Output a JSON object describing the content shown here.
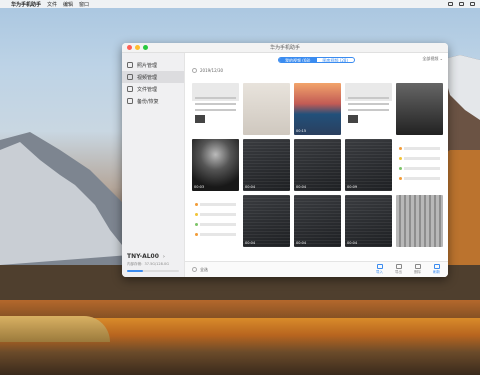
{
  "menubar": {
    "app_name": "华为手机助手",
    "items": [
      "文件",
      "编辑",
      "窗口"
    ],
    "battery": "",
    "icons": [
      "apple-icon",
      "wifi-icon",
      "search-icon",
      "menu-icon"
    ]
  },
  "window": {
    "title": "华为手机助手"
  },
  "sidebar": {
    "items": [
      {
        "label": "照片管理",
        "icon": "photo-icon"
      },
      {
        "label": "视频管理",
        "icon": "video-icon"
      },
      {
        "label": "文件管理",
        "icon": "folder-icon"
      },
      {
        "label": "备份/恢复",
        "icon": "backup-icon"
      }
    ],
    "active_index": 1,
    "device_name": "TNY-AL00",
    "storage_text": "内部存储：37.5G/128.0G",
    "storage_fraction": 0.3
  },
  "main": {
    "segments": [
      "我的视频 (68)",
      "图库视频 (28)"
    ],
    "active_segment": 0,
    "filter_label": "全部视频",
    "date_group": "2019/12/30",
    "thumbnails": [
      {
        "style": "ui",
        "caption": ""
      },
      {
        "style": "foggy",
        "caption": ""
      },
      {
        "style": "sea",
        "caption": "00:15"
      },
      {
        "style": "ui",
        "caption": ""
      },
      {
        "style": "people",
        "caption": ""
      },
      {
        "style": "concert",
        "caption": "00:03"
      },
      {
        "style": "dark",
        "caption": "00:04"
      },
      {
        "style": "dark",
        "caption": "00:04"
      },
      {
        "style": "dark",
        "caption": "00:09"
      },
      {
        "style": "list",
        "caption": ""
      },
      {
        "style": "list",
        "caption": ""
      },
      {
        "style": "dark",
        "caption": "00:04"
      },
      {
        "style": "dark",
        "caption": "00:04"
      },
      {
        "style": "dark",
        "caption": "00:04"
      },
      {
        "style": "building",
        "caption": ""
      }
    ],
    "select_all": "全选",
    "actions": [
      {
        "label": "导入",
        "enabled": true
      },
      {
        "label": "导出",
        "enabled": false
      },
      {
        "label": "删除",
        "enabled": false
      },
      {
        "label": "刷新",
        "enabled": true
      }
    ]
  }
}
